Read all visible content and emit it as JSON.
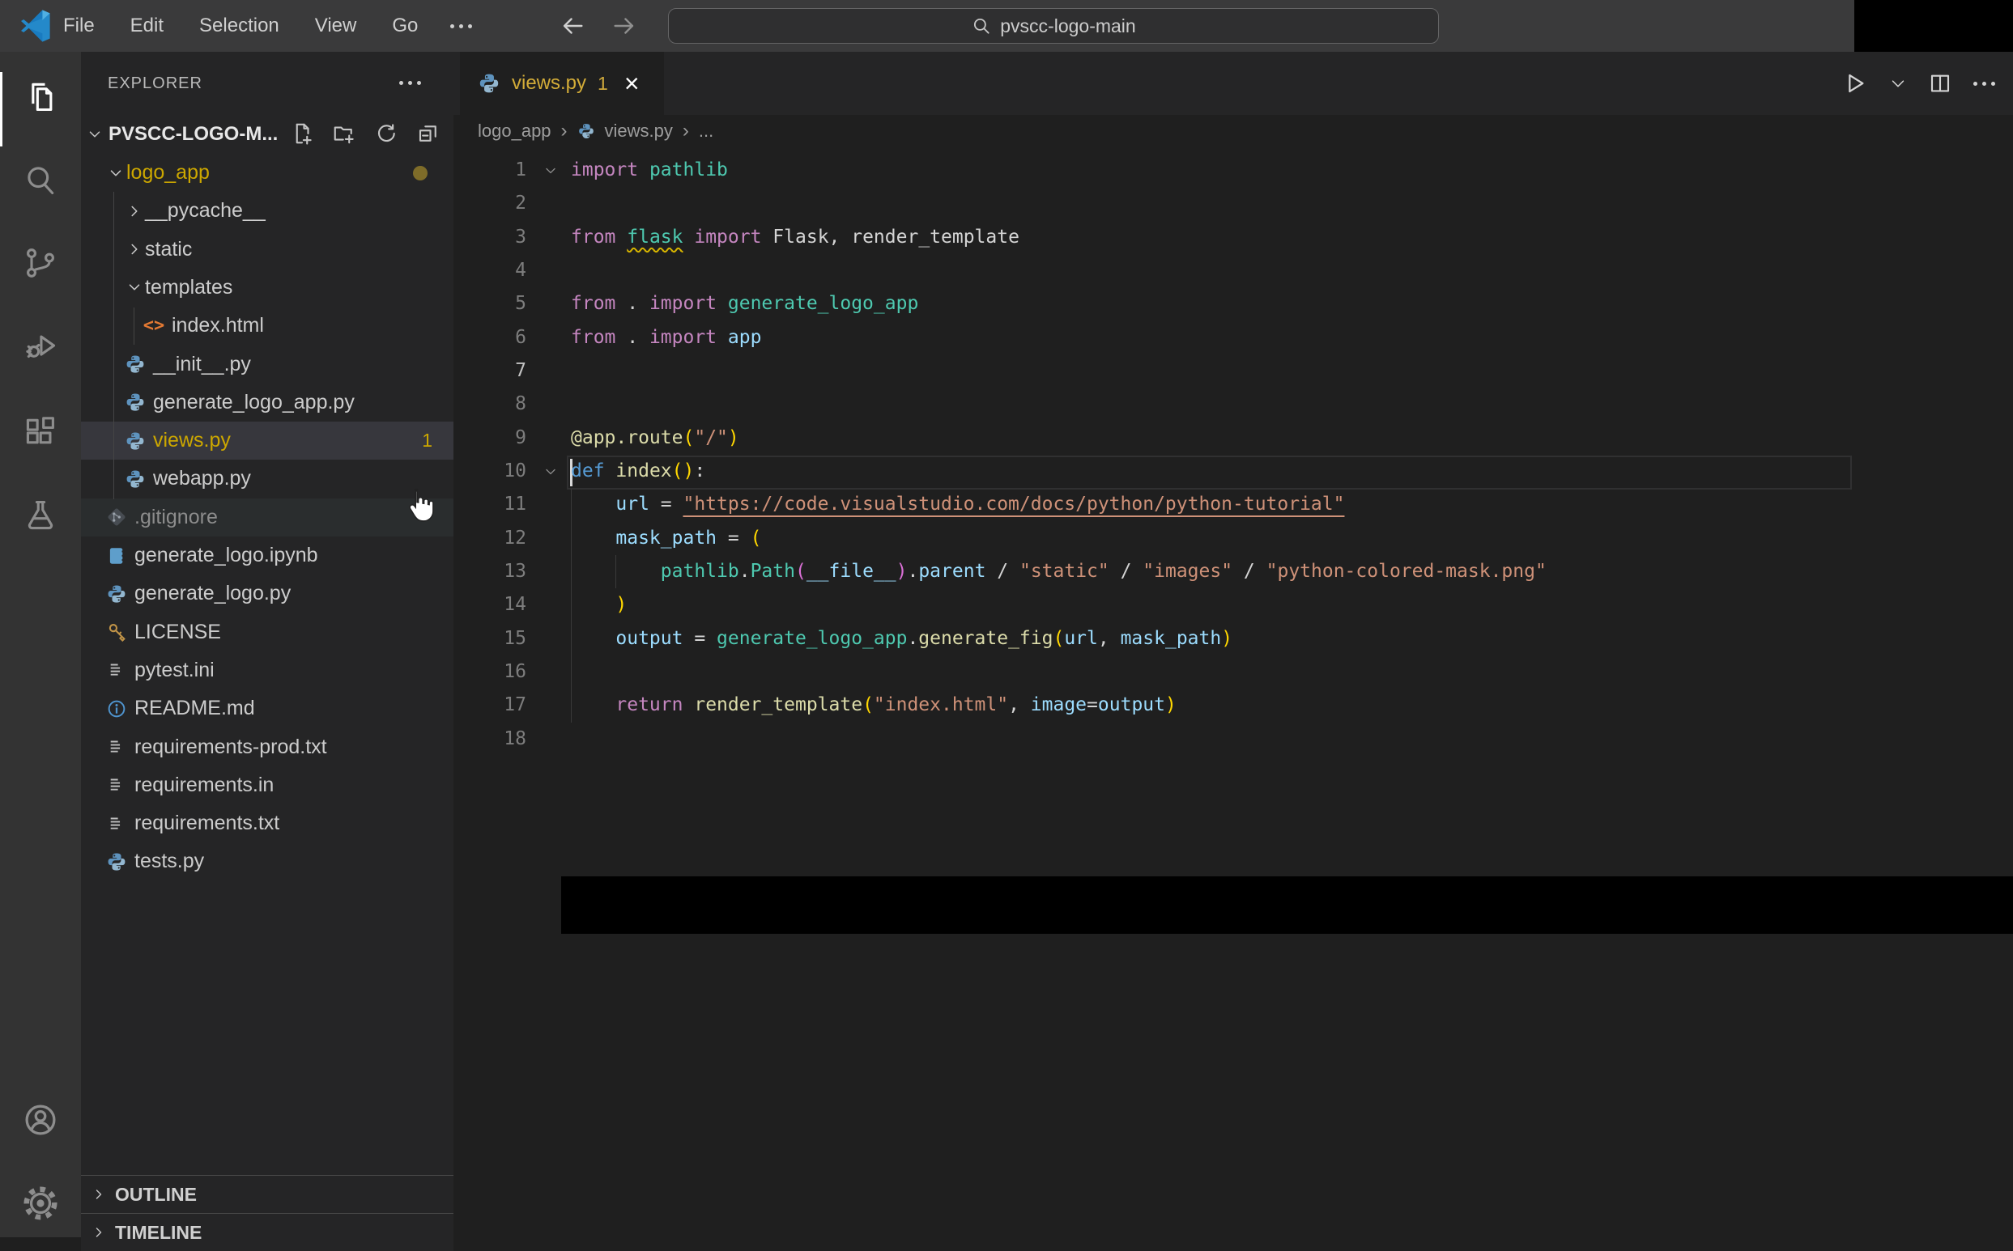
{
  "titlebar": {
    "menus": [
      "File",
      "Edit",
      "Selection",
      "View",
      "Go"
    ],
    "search_value": "pvscc-logo-main"
  },
  "explorer": {
    "title": "EXPLORER",
    "section": "PVSCC-LOGO-M...",
    "outline_label": "OUTLINE",
    "timeline_label": "TIMELINE",
    "tree": [
      {
        "name": "logo_app",
        "kind": "folder",
        "expanded": true,
        "depth": 1,
        "color": "warn",
        "dot": true
      },
      {
        "name": "__pycache__",
        "kind": "folder",
        "expanded": false,
        "depth": 2
      },
      {
        "name": "static",
        "kind": "folder",
        "expanded": false,
        "depth": 2
      },
      {
        "name": "templates",
        "kind": "folder",
        "expanded": true,
        "depth": 2
      },
      {
        "name": "index.html",
        "kind": "file",
        "icon": "html",
        "depth": 3
      },
      {
        "name": "__init__.py",
        "kind": "file",
        "icon": "python",
        "depth": 2
      },
      {
        "name": "generate_logo_app.py",
        "kind": "file",
        "icon": "python",
        "depth": 2
      },
      {
        "name": "views.py",
        "kind": "file",
        "icon": "python",
        "depth": 2,
        "color": "warn",
        "badge": "1",
        "selected": true
      },
      {
        "name": "webapp.py",
        "kind": "file",
        "icon": "python",
        "depth": 2
      },
      {
        "name": ".gitignore",
        "kind": "file",
        "icon": "git",
        "depth": 1,
        "color": "dim",
        "hover": true
      },
      {
        "name": "generate_logo.ipynb",
        "kind": "file",
        "icon": "notebook",
        "depth": 1
      },
      {
        "name": "generate_logo.py",
        "kind": "file",
        "icon": "python",
        "depth": 1
      },
      {
        "name": "LICENSE",
        "kind": "file",
        "icon": "key",
        "depth": 1
      },
      {
        "name": "pytest.ini",
        "kind": "file",
        "icon": "list",
        "depth": 1
      },
      {
        "name": "README.md",
        "kind": "file",
        "icon": "info",
        "depth": 1
      },
      {
        "name": "requirements-prod.txt",
        "kind": "file",
        "icon": "list",
        "depth": 1
      },
      {
        "name": "requirements.in",
        "kind": "file",
        "icon": "list",
        "depth": 1
      },
      {
        "name": "requirements.txt",
        "kind": "file",
        "icon": "list",
        "depth": 1
      },
      {
        "name": "tests.py",
        "kind": "file",
        "icon": "python",
        "depth": 1
      }
    ]
  },
  "editor": {
    "tab": {
      "label": "views.py",
      "badge": "1",
      "close": "×"
    },
    "breadcrumb": [
      "logo_app",
      "views.py",
      "..."
    ],
    "code_lines": [
      {
        "n": 1,
        "fold": true,
        "tokens": [
          [
            "kw",
            "import"
          ],
          [
            "pl",
            " "
          ],
          [
            "type",
            "pathlib"
          ]
        ]
      },
      {
        "n": 2,
        "tokens": []
      },
      {
        "n": 3,
        "tokens": [
          [
            "kw",
            "from"
          ],
          [
            "pl",
            " "
          ],
          [
            "type tk-squiggle",
            "flask"
          ],
          [
            "pl",
            " "
          ],
          [
            "kw",
            "import"
          ],
          [
            "pl",
            " Flask, render_template"
          ]
        ]
      },
      {
        "n": 4,
        "tokens": []
      },
      {
        "n": 5,
        "tokens": [
          [
            "kw",
            "from"
          ],
          [
            "pl",
            " . "
          ],
          [
            "kw",
            "import"
          ],
          [
            "pl",
            " "
          ],
          [
            "type",
            "generate_logo_app"
          ]
        ]
      },
      {
        "n": 6,
        "tokens": [
          [
            "kw",
            "from"
          ],
          [
            "pl",
            " . "
          ],
          [
            "kw",
            "import"
          ],
          [
            "pl",
            " "
          ],
          [
            "var",
            "app"
          ]
        ]
      },
      {
        "n": 7,
        "cursor": true,
        "tokens": []
      },
      {
        "n": 8,
        "tokens": []
      },
      {
        "n": 9,
        "tokens": [
          [
            "fn",
            "@app.route"
          ],
          [
            "b1",
            "("
          ],
          [
            "str",
            "\"/\""
          ],
          [
            "b1",
            ")"
          ]
        ]
      },
      {
        "n": 10,
        "fold": true,
        "tokens": [
          [
            "def",
            "def"
          ],
          [
            "pl",
            " "
          ],
          [
            "fn",
            "index"
          ],
          [
            "b1",
            "()"
          ],
          [
            "pl",
            ":"
          ]
        ]
      },
      {
        "n": 11,
        "tokens": [
          [
            "pl",
            "    "
          ],
          [
            "var",
            "url"
          ],
          [
            "pl",
            " = "
          ],
          [
            "str tk-link",
            "\"https://code.visualstudio.com/docs/python/python-tutorial\""
          ]
        ]
      },
      {
        "n": 12,
        "tokens": [
          [
            "pl",
            "    "
          ],
          [
            "var",
            "mask_path"
          ],
          [
            "pl",
            " = "
          ],
          [
            "b1",
            "("
          ]
        ]
      },
      {
        "n": 13,
        "tokens": [
          [
            "pl",
            "        "
          ],
          [
            "type",
            "pathlib"
          ],
          [
            "pl",
            "."
          ],
          [
            "type",
            "Path"
          ],
          [
            "b2",
            "("
          ],
          [
            "var",
            "__file__"
          ],
          [
            "b2",
            ")"
          ],
          [
            "pl",
            "."
          ],
          [
            "var",
            "parent"
          ],
          [
            "pl",
            " / "
          ],
          [
            "str",
            "\"static\""
          ],
          [
            "pl",
            " / "
          ],
          [
            "str",
            "\"images\""
          ],
          [
            "pl",
            " / "
          ],
          [
            "str",
            "\"python-colored-mask.png\""
          ]
        ]
      },
      {
        "n": 14,
        "tokens": [
          [
            "pl",
            "    "
          ],
          [
            "b1",
            ")"
          ]
        ]
      },
      {
        "n": 15,
        "tokens": [
          [
            "pl",
            "    "
          ],
          [
            "var",
            "output"
          ],
          [
            "pl",
            " = "
          ],
          [
            "type",
            "generate_logo_app"
          ],
          [
            "pl",
            "."
          ],
          [
            "fn",
            "generate_fig"
          ],
          [
            "b1",
            "("
          ],
          [
            "var",
            "url"
          ],
          [
            "pl",
            ", "
          ],
          [
            "var",
            "mask_path"
          ],
          [
            "b1",
            ")"
          ]
        ]
      },
      {
        "n": 16,
        "tokens": []
      },
      {
        "n": 17,
        "tokens": [
          [
            "pl",
            "    "
          ],
          [
            "kw",
            "return"
          ],
          [
            "pl",
            " "
          ],
          [
            "fn",
            "render_template"
          ],
          [
            "b1",
            "("
          ],
          [
            "str",
            "\"index.html\""
          ],
          [
            "pl",
            ", "
          ],
          [
            "var",
            "image"
          ],
          [
            "pl",
            "="
          ],
          [
            "var",
            "output"
          ],
          [
            "b1",
            ")"
          ]
        ]
      },
      {
        "n": 18,
        "tokens": []
      }
    ]
  },
  "colors": {
    "keyword": "#C586C0",
    "type": "#4EC9B0",
    "variable": "#9CDCFE",
    "function": "#DCDCAA",
    "string": "#CE9178",
    "plain": "#D4D4D4",
    "def_keyword": "#569CD6",
    "bracket_level1": "#FFD700",
    "bracket_level2": "#DA70D6",
    "warning_yellow": "#CCA700",
    "git_ignored": "#8C8C8C",
    "modified_dot": "#7E6C29",
    "editor_bg": "#1F1F1F",
    "sidebar_bg": "#252526",
    "activitybar_bg": "#333333",
    "titlebar_bg": "#3A3A3B",
    "selected_row": "#37373D"
  }
}
